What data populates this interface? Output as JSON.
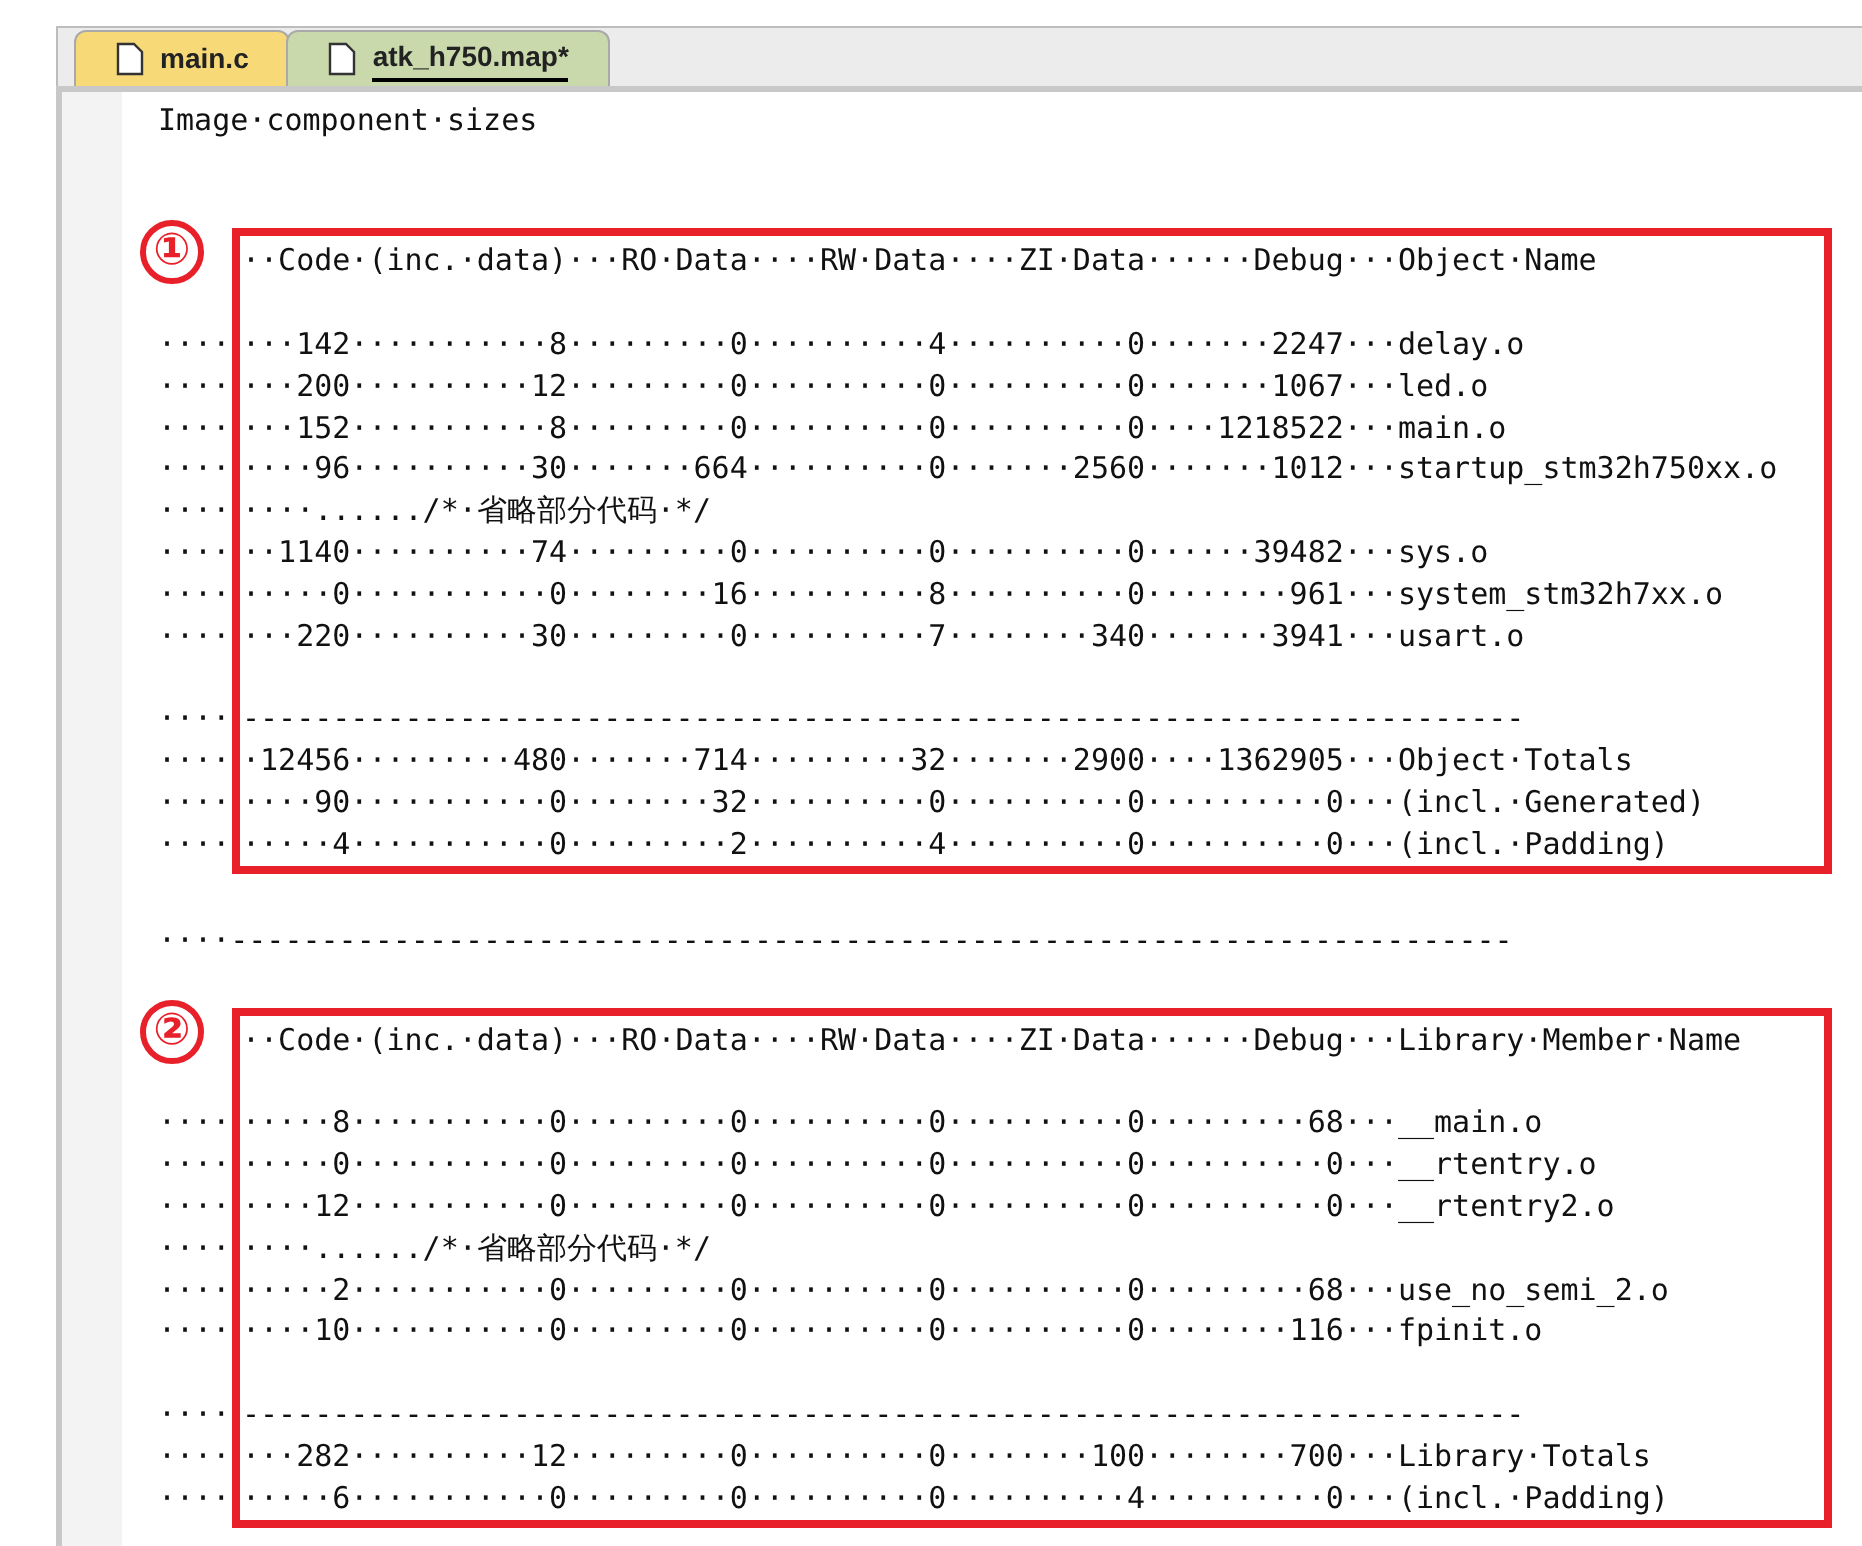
{
  "tabs": [
    {
      "label": "main.c",
      "selected": false,
      "color": "#f8d978"
    },
    {
      "label": "atk_h750.map*",
      "selected": true,
      "color": "#c9d9ab"
    }
  ],
  "editor": {
    "lines": [
      {
        "kind": "text",
        "text": "Image·component·sizes"
      },
      {
        "kind": "blank"
      },
      {
        "kind": "blank"
      },
      {
        "kind": "group",
        "marker": "①",
        "lines": [
          {
            "kind": "text",
            "text": "··Code·(inc.·data)···RO·Data····RW·Data····ZI·Data······Debug···Object·Name"
          },
          {
            "kind": "blank"
          },
          {
            "kind": "text",
            "lead": "····",
            "text": "···142···········8·········0··········4··········0·······2247···delay.o"
          },
          {
            "kind": "text",
            "lead": "····",
            "text": "···200··········12·········0··········0··········0·······1067···led.o"
          },
          {
            "kind": "text",
            "lead": "····",
            "text": "···152···········8·········0··········0··········0····1218522···main.o"
          },
          {
            "kind": "text",
            "lead": "····",
            "text": "····96··········30·······664··········0·······2560·······1012···startup_stm32h750xx.o"
          },
          {
            "kind": "text",
            "lead": "····",
            "text": "····....../*·省略部分代码·*/"
          },
          {
            "kind": "text",
            "lead": "····",
            "text": "··1140··········74·········0··········0··········0······39482···sys.o"
          },
          {
            "kind": "text",
            "lead": "····",
            "text": "·····0···········0········16··········8··········0········961···system_stm32h7xx.o"
          },
          {
            "kind": "text",
            "lead": "····",
            "text": "···220··········30·········0··········7········340·······3941···usart.o"
          },
          {
            "kind": "blank"
          },
          {
            "kind": "text",
            "lead": "····",
            "text": "-----------------------------------------------------------------------"
          },
          {
            "kind": "text",
            "lead": "····",
            "text": "·12456·········480·······714·········32·······2900····1362905···Object·Totals"
          },
          {
            "kind": "text",
            "lead": "····",
            "text": "····90···········0········32··········0··········0··········0···(incl.·Generated)"
          },
          {
            "kind": "text",
            "lead": "····",
            "text": "·····4···········0·········2··········4··········0··········0···(incl.·Padding)"
          }
        ]
      },
      {
        "kind": "blank"
      },
      {
        "kind": "text",
        "text": "····-----------------------------------------------------------------------"
      },
      {
        "kind": "blank"
      },
      {
        "kind": "group",
        "marker": "②",
        "lines": [
          {
            "kind": "text",
            "text": "··Code·(inc.·data)···RO·Data····RW·Data····ZI·Data······Debug···Library·Member·Name"
          },
          {
            "kind": "blank"
          },
          {
            "kind": "text",
            "lead": "····",
            "text": "·····8···········0·········0··········0··········0·········68···__main.o"
          },
          {
            "kind": "text",
            "lead": "····",
            "text": "·····0···········0·········0··········0··········0··········0···__rtentry.o"
          },
          {
            "kind": "text",
            "lead": "····",
            "text": "····12···········0·········0··········0··········0··········0···__rtentry2.o"
          },
          {
            "kind": "text",
            "lead": "····",
            "text": "····....../*·省略部分代码·*/"
          },
          {
            "kind": "text",
            "lead": "····",
            "text": "·····2···········0·········0··········0··········0·········68···use_no_semi_2.o"
          },
          {
            "kind": "text",
            "lead": "····",
            "text": "····10···········0·········0··········0··········0········116···fpinit.o"
          },
          {
            "kind": "blank"
          },
          {
            "kind": "text",
            "lead": "····",
            "text": "-----------------------------------------------------------------------"
          },
          {
            "kind": "text",
            "lead": "····",
            "text": "···282··········12·········0··········0········100········700···Library·Totals"
          },
          {
            "kind": "text",
            "lead": "····",
            "text": "·····6···········0·········0··········0··········4··········0···(incl.·Padding)"
          }
        ]
      }
    ]
  }
}
